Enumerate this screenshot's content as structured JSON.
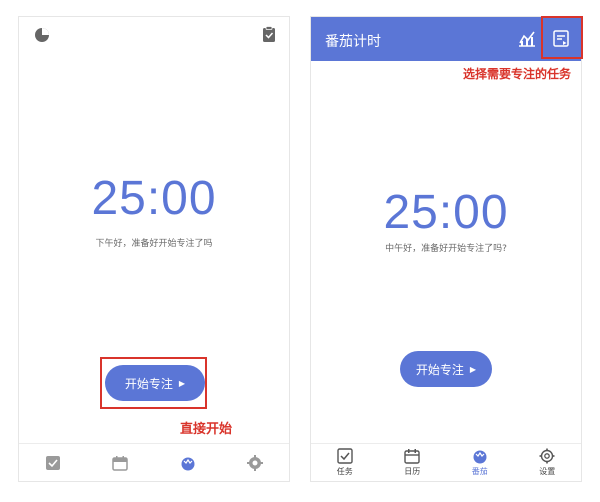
{
  "left_phone": {
    "timer": "25:00",
    "greeting": "下午好，准备好开始专注了吗",
    "start_label": "开始专注",
    "start_arrow": "▶",
    "tabs": [
      {
        "label": "",
        "icon": "checkbox-icon"
      },
      {
        "label": "",
        "icon": "calendar-icon"
      },
      {
        "label": "",
        "icon": "tomato-icon",
        "active": true
      },
      {
        "label": "",
        "icon": "gear-icon"
      }
    ]
  },
  "right_phone": {
    "app_title": "番茄计时",
    "timer": "25:00",
    "greeting": "中午好，准备好开始专注了吗?",
    "start_label": "开始专注",
    "start_arrow": "▶",
    "tabs": [
      {
        "label": "任务",
        "icon": "checkbox-icon"
      },
      {
        "label": "日历",
        "icon": "calendar-icon"
      },
      {
        "label": "番茄",
        "icon": "tomato-icon",
        "active": true
      },
      {
        "label": "设置",
        "icon": "gear-icon"
      }
    ]
  },
  "annotations": {
    "start_note": "直接开始",
    "tasklist_note": "选择需要专注的任务"
  },
  "colors": {
    "accent": "#5b76d6",
    "annotation": "#d9342b",
    "icon_gray": "#9a9a9a"
  }
}
